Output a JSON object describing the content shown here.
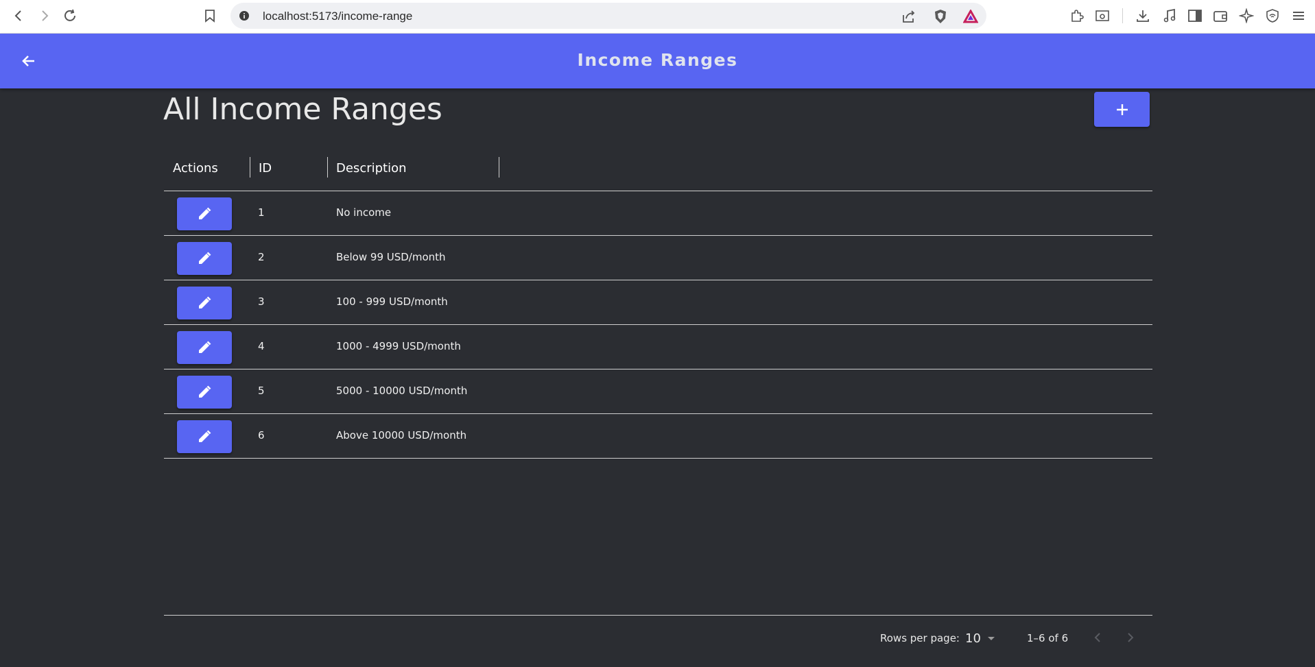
{
  "browser": {
    "url": "localhost:5173/income-range"
  },
  "appbar": {
    "title": "Income Ranges"
  },
  "page": {
    "heading": "All Income Ranges"
  },
  "table": {
    "headers": {
      "actions": "Actions",
      "id": "ID",
      "description": "Description"
    },
    "rows": [
      {
        "id": "1",
        "description": "No income"
      },
      {
        "id": "2",
        "description": "Below 99 USD/month"
      },
      {
        "id": "3",
        "description": "100 - 999 USD/month"
      },
      {
        "id": "4",
        "description": "1000 - 4999 USD/month"
      },
      {
        "id": "5",
        "description": "5000 - 10000 USD/month"
      },
      {
        "id": "6",
        "description": "Above 10000 USD/month"
      }
    ]
  },
  "pagination": {
    "rows_per_page_label": "Rows per page:",
    "rows_per_page_value": "10",
    "range": "1–6 of 6"
  },
  "colors": {
    "accent": "#5865f2",
    "background": "#2b2d32"
  }
}
